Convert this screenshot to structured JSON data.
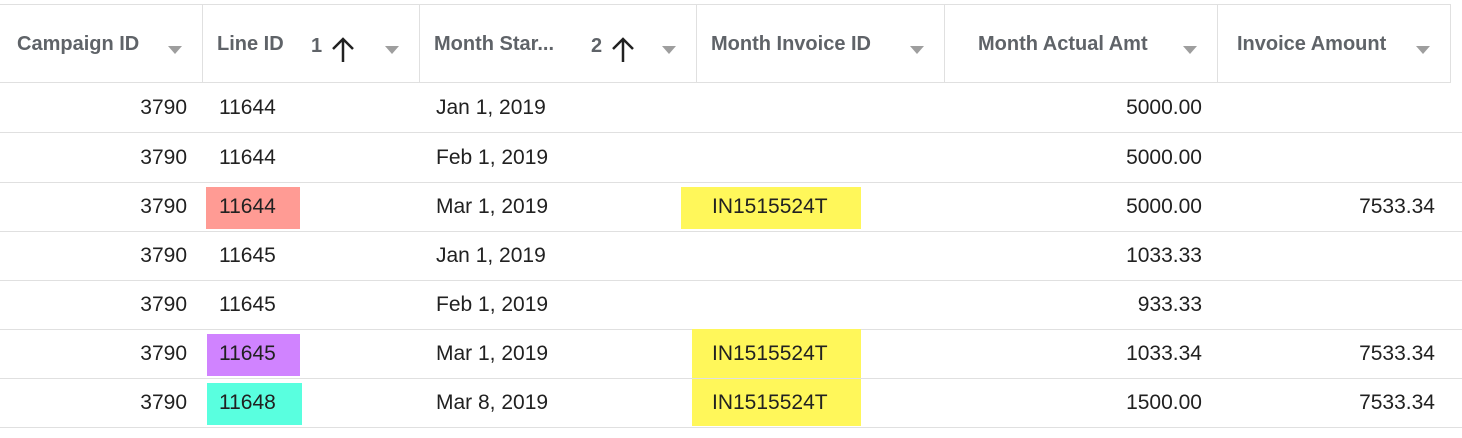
{
  "columns": [
    {
      "title": "Campaign ID"
    },
    {
      "title": "Line ID",
      "sort_order": "1"
    },
    {
      "title": "Month Star...",
      "sort_order": "2"
    },
    {
      "title": "Month Invoice ID"
    },
    {
      "title": "Month Actual Amt"
    },
    {
      "title": "Invoice Amount"
    }
  ],
  "rows": [
    {
      "campaign_id": "3790",
      "line_id": "11644",
      "month_start": "Jan 1, 2019",
      "invoice_id": "",
      "actual_amt": "5000.00",
      "invoice_amt": ""
    },
    {
      "campaign_id": "3790",
      "line_id": "11644",
      "month_start": "Feb 1, 2019",
      "invoice_id": "",
      "actual_amt": "5000.00",
      "invoice_amt": ""
    },
    {
      "campaign_id": "3790",
      "line_id": "11644",
      "month_start": "Mar 1, 2019",
      "invoice_id": "IN1515524T",
      "actual_amt": "5000.00",
      "invoice_amt": "7533.34"
    },
    {
      "campaign_id": "3790",
      "line_id": "11645",
      "month_start": "Jan 1, 2019",
      "invoice_id": "",
      "actual_amt": "1033.33",
      "invoice_amt": ""
    },
    {
      "campaign_id": "3790",
      "line_id": "11645",
      "month_start": "Feb 1, 2019",
      "invoice_id": "",
      "actual_amt": "933.33",
      "invoice_amt": ""
    },
    {
      "campaign_id": "3790",
      "line_id": "11645",
      "month_start": "Mar 1, 2019",
      "invoice_id": "IN1515524T",
      "actual_amt": "1033.34",
      "invoice_amt": "7533.34"
    },
    {
      "campaign_id": "3790",
      "line_id": "11648",
      "month_start": "Mar 8, 2019",
      "invoice_id": "IN1515524T",
      "actual_amt": "1500.00",
      "invoice_amt": "7533.34"
    }
  ],
  "highlight_colors": {
    "salmon": "#ff9b94",
    "purple": "#d083ff",
    "teal": "#59ffdf",
    "yellow": "#fff75a"
  },
  "icons": {
    "sort_ascending": "arrow-up-icon",
    "column_menu": "caret-down-icon"
  }
}
